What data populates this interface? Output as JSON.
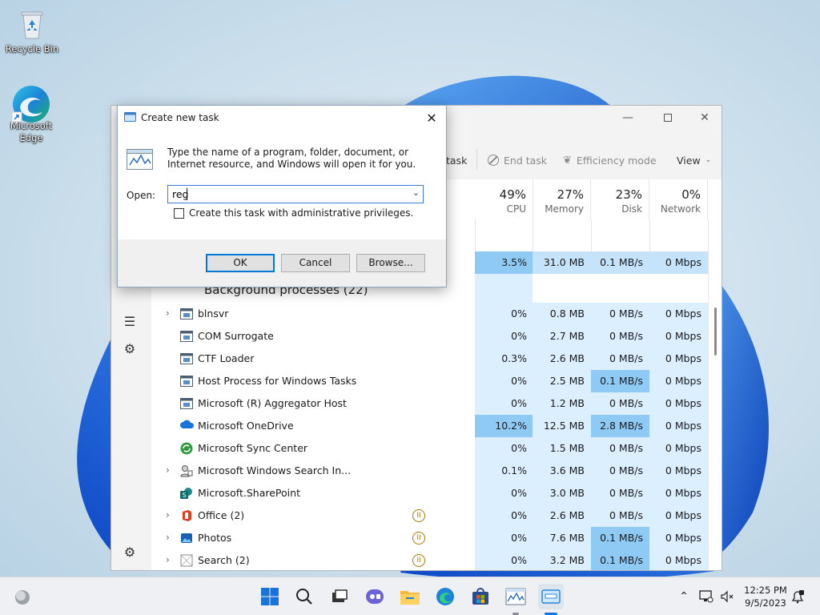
{
  "desktop": {
    "icons": [
      {
        "name": "recycle-bin",
        "label": "Recycle Bin"
      },
      {
        "name": "microsoft-edge",
        "label": "Microsoft Edge"
      }
    ]
  },
  "task_manager": {
    "commands": {
      "run_new_task": "task",
      "end_task": "End task",
      "efficiency_mode": "Efficiency mode",
      "view": "View"
    },
    "columns": [
      {
        "pct": "49%",
        "label": "CPU"
      },
      {
        "pct": "27%",
        "label": "Memory"
      },
      {
        "pct": "23%",
        "label": "Disk"
      },
      {
        "pct": "0%",
        "label": "Network"
      }
    ],
    "app_summary_row": {
      "cpu": "3.5%",
      "memory": "31.0 MB",
      "disk": "0.1 MB/s",
      "network": "0 Mbps"
    },
    "section_title": "Background processes (22)",
    "processes": [
      {
        "name": "blnsvr",
        "expandable": true,
        "icon": "service-icon",
        "status": "",
        "cpu": "0%",
        "memory": "0.8 MB",
        "disk": "0 MB/s",
        "network": "0 Mbps"
      },
      {
        "name": "COM Surrogate",
        "expandable": false,
        "icon": "service-icon",
        "status": "",
        "cpu": "0%",
        "memory": "2.7 MB",
        "disk": "0 MB/s",
        "network": "0 Mbps"
      },
      {
        "name": "CTF Loader",
        "expandable": false,
        "icon": "service-icon",
        "status": "",
        "cpu": "0.3%",
        "memory": "2.6 MB",
        "disk": "0 MB/s",
        "network": "0 Mbps"
      },
      {
        "name": "Host Process for Windows Tasks",
        "expandable": false,
        "icon": "service-icon",
        "status": "",
        "cpu": "0%",
        "memory": "2.5 MB",
        "disk": "0.1 MB/s",
        "network": "0 Mbps"
      },
      {
        "name": "Microsoft (R) Aggregator Host",
        "expandable": false,
        "icon": "service-icon",
        "status": "",
        "cpu": "0%",
        "memory": "1.2 MB",
        "disk": "0 MB/s",
        "network": "0 Mbps"
      },
      {
        "name": "Microsoft OneDrive",
        "expandable": false,
        "icon": "onedrive-icon",
        "status": "",
        "cpu": "10.2%",
        "memory": "12.5 MB",
        "disk": "2.8 MB/s",
        "network": "0 Mbps"
      },
      {
        "name": "Microsoft Sync Center",
        "expandable": false,
        "icon": "sync-center-icon",
        "status": "",
        "cpu": "0%",
        "memory": "1.5 MB",
        "disk": "0 MB/s",
        "network": "0 Mbps"
      },
      {
        "name": "Microsoft Windows Search In...",
        "expandable": true,
        "icon": "search-indexer-icon",
        "status": "",
        "cpu": "0.1%",
        "memory": "3.6 MB",
        "disk": "0 MB/s",
        "network": "0 Mbps"
      },
      {
        "name": "Microsoft.SharePoint",
        "expandable": false,
        "icon": "sharepoint-icon",
        "status": "",
        "cpu": "0%",
        "memory": "3.0 MB",
        "disk": "0 MB/s",
        "network": "0 Mbps"
      },
      {
        "name": "Office (2)",
        "expandable": true,
        "icon": "office-icon",
        "status": "suspended",
        "cpu": "0%",
        "memory": "2.6 MB",
        "disk": "0 MB/s",
        "network": "0 Mbps"
      },
      {
        "name": "Photos",
        "expandable": true,
        "icon": "photos-icon",
        "status": "suspended",
        "cpu": "0%",
        "memory": "7.6 MB",
        "disk": "0.1 MB/s",
        "network": "0 Mbps"
      },
      {
        "name": "Search (2)",
        "expandable": true,
        "icon": "search-app-icon",
        "status": "suspended",
        "cpu": "0%",
        "memory": "3.2 MB",
        "disk": "0.1 MB/s",
        "network": "0 Mbps"
      }
    ]
  },
  "dialog": {
    "title": "Create new task",
    "description": "Type the name of a program, folder, document, or Internet resource, and Windows will open it for you.",
    "open_label": "Open:",
    "open_value": "reg",
    "admin_checkbox_label": "Create this task with administrative privileges.",
    "admin_checked": false,
    "ok": "OK",
    "cancel": "Cancel",
    "browse": "Browse..."
  },
  "taskbar": {
    "time": "12:25 PM",
    "date": "9/5/2023",
    "pinned": [
      "start-icon",
      "search-icon",
      "task-view-icon",
      "chat-icon",
      "file-explorer-icon",
      "edge-icon",
      "store-icon",
      "task-manager-icon",
      "run-dialog-icon"
    ]
  },
  "colors": {
    "accent": "#0078d7",
    "heat_low": "#dcefff",
    "heat_mid": "#c5e3fb",
    "heat_high": "#8fcaf5"
  }
}
